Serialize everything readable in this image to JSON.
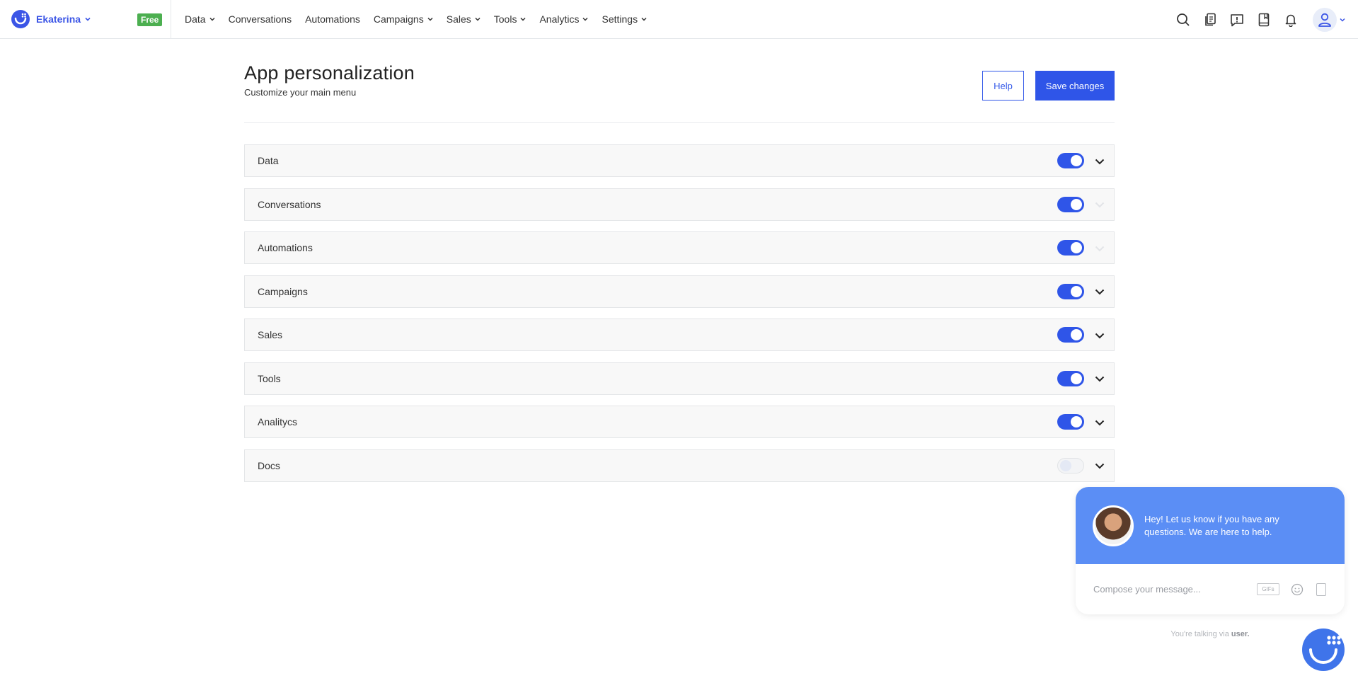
{
  "brand": {
    "name": "Ekaterina",
    "plan_badge": "Free"
  },
  "nav": [
    {
      "label": "Data",
      "dropdown": true
    },
    {
      "label": "Conversations",
      "dropdown": false
    },
    {
      "label": "Automations",
      "dropdown": false
    },
    {
      "label": "Campaigns",
      "dropdown": true
    },
    {
      "label": "Sales",
      "dropdown": true
    },
    {
      "label": "Tools",
      "dropdown": true
    },
    {
      "label": "Analytics",
      "dropdown": true
    },
    {
      "label": "Settings",
      "dropdown": true
    }
  ],
  "top_icons": [
    "search-icon",
    "documents-icon",
    "feedback-icon",
    "book-icon",
    "bell-icon"
  ],
  "page": {
    "title": "App personalization",
    "subtitle": "Customize your main menu",
    "help_label": "Help",
    "save_label": "Save changes"
  },
  "menu_rows": [
    {
      "label": "Data",
      "enabled": true,
      "expandable": true
    },
    {
      "label": "Conversations",
      "enabled": true,
      "expandable": false
    },
    {
      "label": "Automations",
      "enabled": true,
      "expandable": false
    },
    {
      "label": "Campaigns",
      "enabled": true,
      "expandable": true
    },
    {
      "label": "Sales",
      "enabled": true,
      "expandable": true
    },
    {
      "label": "Tools",
      "enabled": true,
      "expandable": true
    },
    {
      "label": "Analitycs",
      "enabled": true,
      "expandable": true
    },
    {
      "label": "Docs",
      "enabled": false,
      "expandable": true
    }
  ],
  "chat": {
    "message": "Hey! Let us know if you have any questions. We are here to help.",
    "input_placeholder": "Compose your message...",
    "gifs_label": "GIFs",
    "via_prefix": "You're talking via",
    "via_name": "user."
  },
  "colors": {
    "accent": "#2f55e8",
    "chat_header": "#5b8ef5",
    "free_badge": "#4caf50"
  }
}
